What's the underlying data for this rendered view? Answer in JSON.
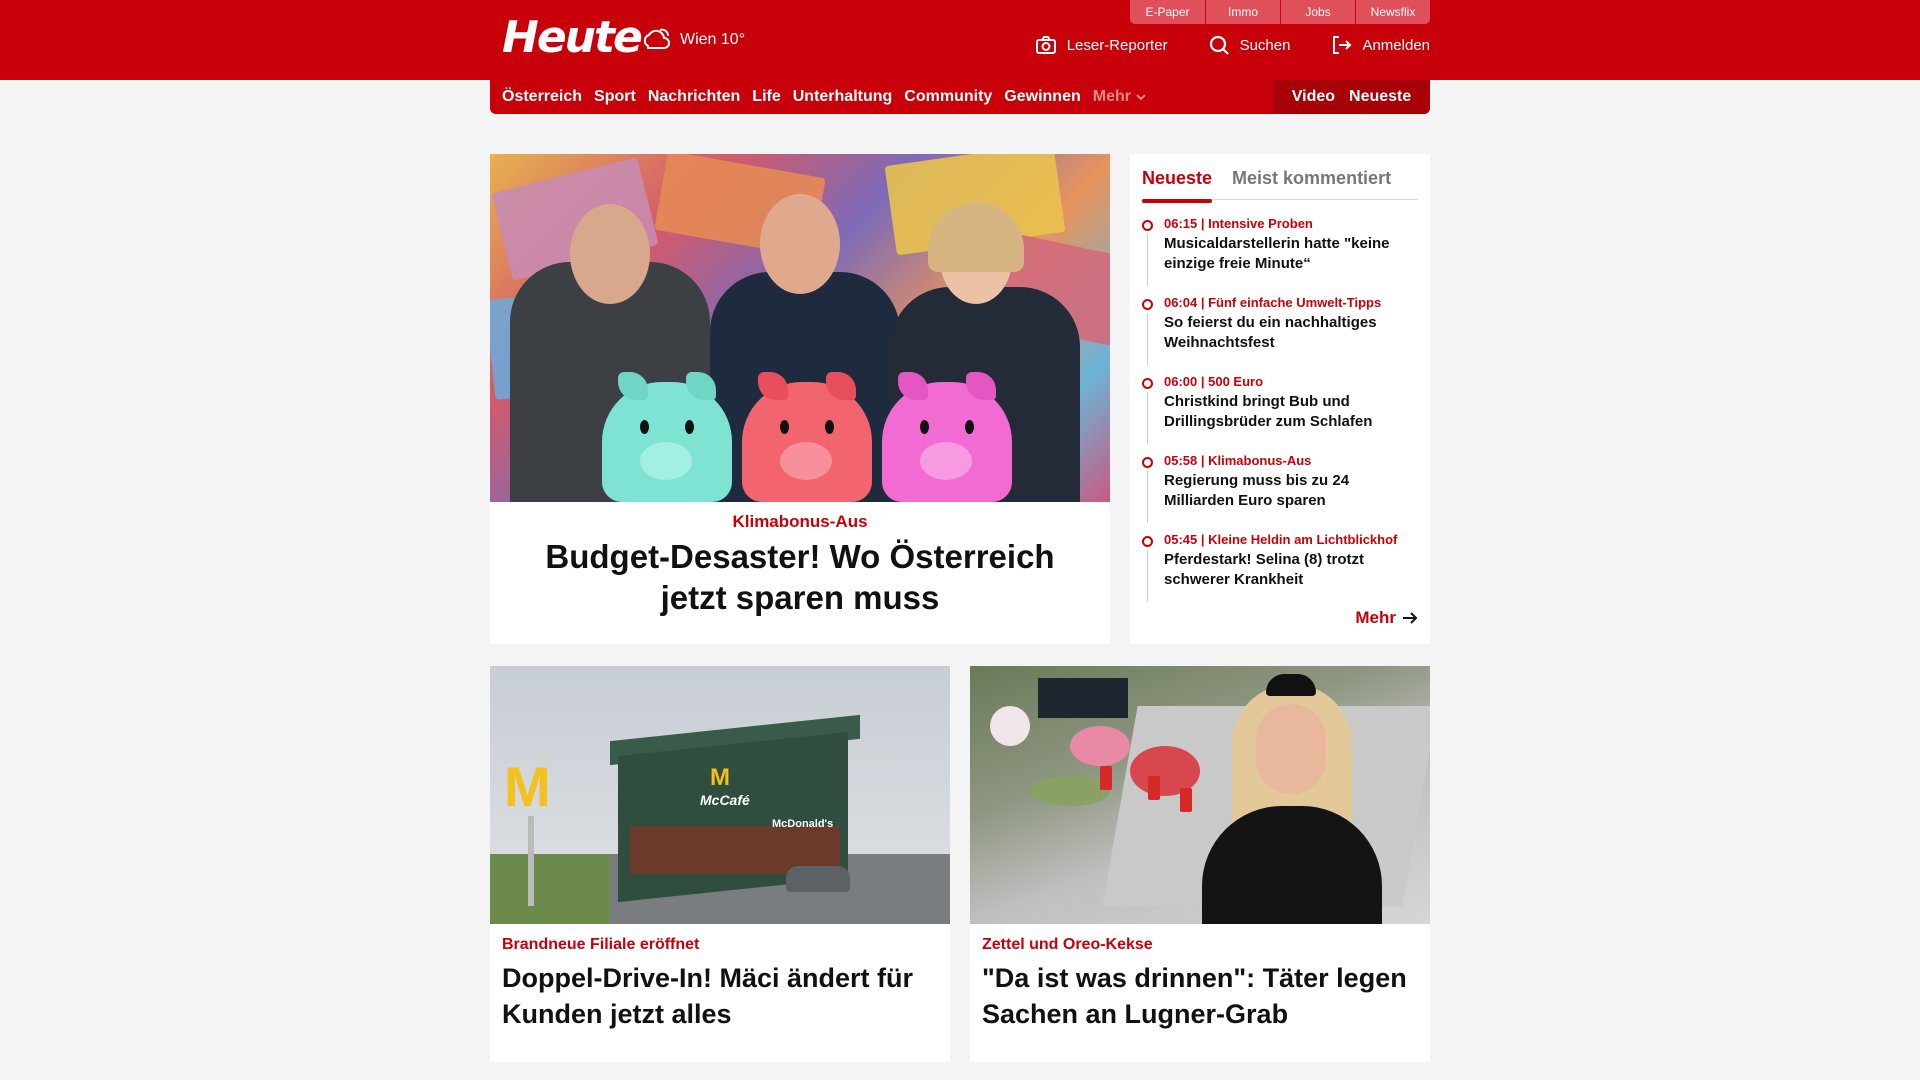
{
  "brand": {
    "logo": "Heute",
    "weather": "Wien 10°",
    "red": "#c8000a"
  },
  "services": [
    "E-Paper",
    "Immo",
    "Jobs",
    "Newsflix"
  ],
  "actions": [
    {
      "icon": "camera-icon",
      "label": "Leser-Reporter"
    },
    {
      "icon": "search-icon",
      "label": "Suchen"
    },
    {
      "icon": "login-icon",
      "label": "Anmelden"
    }
  ],
  "nav": {
    "items": [
      "Österreich",
      "Sport",
      "Nachrichten",
      "Life",
      "Unterhaltung",
      "Community",
      "Gewinnen"
    ],
    "more": "Mehr",
    "right": [
      "Video",
      "Neueste"
    ]
  },
  "hero": {
    "kicker": "Klimabonus-Aus",
    "title": "Budget-Desaster! Wo Österreich jetzt sparen muss"
  },
  "sidebar": {
    "tabs": [
      "Neueste",
      "Meist kommentiert"
    ],
    "items": [
      {
        "meta": "06:15 | Intensive Proben",
        "title": "Musicaldarstellerin hatte \"keine einzige freie Minute“"
      },
      {
        "meta": "06:04 | Fünf einfache Umwelt-Tipps",
        "title": "So feierst du ein nachhaltiges Weihnachtsfest"
      },
      {
        "meta": "06:00 | 500 Euro",
        "title": "Christkind bringt Bub und Drillingsbrüder zum Schlafen"
      },
      {
        "meta": "05:58 | Klimabonus-Aus",
        "title": "Regierung muss bis zu 24 Milliarden Euro sparen"
      },
      {
        "meta": "05:45 | Kleine Heldin am Lichtblickhof",
        "title": "Pferdestark! Selina (8) trotzt schwerer Krankheit"
      }
    ],
    "more": "Mehr"
  },
  "cards": [
    {
      "kicker": "Brandneue Filiale eröffnet",
      "title": "Doppel-Drive-In! Mäci ändert für Kunden jetzt alles",
      "image_text": [
        "McCafé",
        "McDonald's"
      ]
    },
    {
      "kicker": "Zettel und Oreo-Kekse",
      "title": "\"Da ist was drinnen\": Täter legen Sachen an Lugner-Grab"
    }
  ]
}
